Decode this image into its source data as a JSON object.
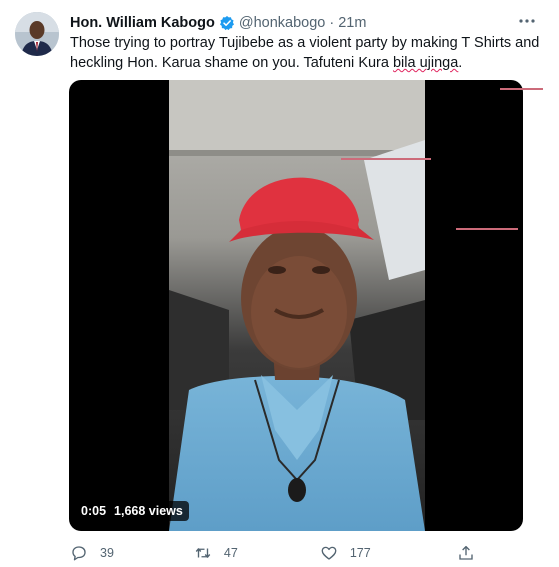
{
  "tweet": {
    "author_name": "Hon. William Kabogo",
    "handle": "@honkabogo",
    "separator": "·",
    "time": "21m",
    "verified": true,
    "text_lines": [
      "Those trying to portray  Tujibebe as a violent party by making T Shirts and",
      "heckling Hon. Karua shame on you. Tafuteni "
    ],
    "text_tail_plain": "Kura ",
    "text_tail_marked": "bila ujinga",
    "text_end": "."
  },
  "video": {
    "duration": "0:05",
    "views": "1,668 views"
  },
  "actions": {
    "replies": "39",
    "retweets": "47",
    "likes": "177"
  },
  "colors": {
    "accent": "#1d9bf0",
    "muted": "#536471",
    "annotation": "#cc6b7a"
  },
  "icons": [
    "verified-badge-icon",
    "more-icon",
    "reply-icon",
    "retweet-icon",
    "like-icon",
    "share-icon"
  ]
}
